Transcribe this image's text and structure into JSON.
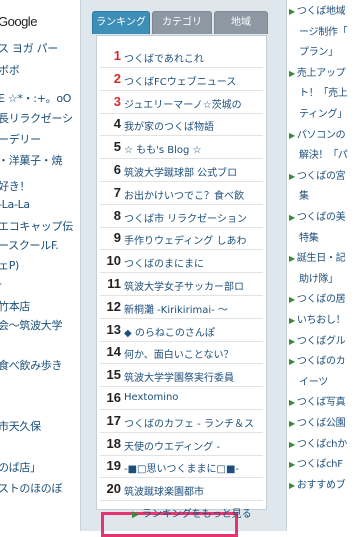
{
  "left_column": {
    "google_label": "Google",
    "items": [
      "ス ヨガ パー",
      "ボボ",
      "E ☆*・:+。oO",
      "長リラクゼーシ",
      "ーデリー",
      "・洋菓子・焼",
      "好き！",
      "-La-La",
      "エコキャップ伝",
      "ースクールF.",
      "ェP)",
      "-",
      "竹本店",
      "会〜筑波大学",
      "",
      "食べ飲み歩き",
      "",
      "",
      "市天久保",
      "",
      "のば店」",
      "ストのほのぼ"
    ]
  },
  "tabs": [
    {
      "label": "ランキング",
      "active": true
    },
    {
      "label": "カテゴリ",
      "active": false
    },
    {
      "label": "地域",
      "active": false
    }
  ],
  "ranking": [
    {
      "rank": "1",
      "title": "つくばであれこれ"
    },
    {
      "rank": "2",
      "title": "つくばFCウェブニュース"
    },
    {
      "rank": "3",
      "title": "ジュエリーマーノ☆茨城の"
    },
    {
      "rank": "4",
      "title": "我が家のつくば物語"
    },
    {
      "rank": "5",
      "title": "☆ もも's Blog ☆"
    },
    {
      "rank": "6",
      "title": "筑波大学蹴球部 公式ブロ"
    },
    {
      "rank": "7",
      "title": "お出かけいつでこ？食べ飲"
    },
    {
      "rank": "8",
      "title": "つくば市 リラクゼーション"
    },
    {
      "rank": "9",
      "title": "手作りウェディング しあわ"
    },
    {
      "rank": "10",
      "title": "つくばのまにまに"
    },
    {
      "rank": "11",
      "title": "筑波大学女子サッカー部ロ"
    },
    {
      "rank": "12",
      "title": "新桐灘 -Kirikirimai- 〜"
    },
    {
      "rank": "13",
      "title": "◆ のらねこのさんぽ"
    },
    {
      "rank": "14",
      "title": "何か、面白いことない？"
    },
    {
      "rank": "15",
      "title": "筑波大学学園祭実行委員"
    },
    {
      "rank": "16",
      "title": "Hextomino"
    },
    {
      "rank": "17",
      "title": "つくばのカフェ - ランチ＆ス"
    },
    {
      "rank": "18",
      "title": "天使のウエディング -"
    },
    {
      "rank": "19",
      "title": "-■□思いつくままに□■-"
    },
    {
      "rank": "20",
      "title": "筑波蹴球楽園都市"
    }
  ],
  "more_link": "ランキングをもっと見る",
  "right_column": [
    {
      "text": "つくば地域",
      "arrow": true
    },
    {
      "text": "ージ制作「",
      "arrow": false
    },
    {
      "text": "プラン」",
      "arrow": false
    },
    {
      "text": "売上アップ",
      "arrow": true
    },
    {
      "text": "ト！「売上",
      "arrow": false
    },
    {
      "text": "ティング」",
      "arrow": false
    },
    {
      "text": "パソコンの",
      "arrow": true
    },
    {
      "text": "解決！「パ",
      "arrow": false
    },
    {
      "text": "つくばの宮",
      "arrow": true
    },
    {
      "text": "集",
      "arrow": false
    },
    {
      "text": "つくばの美",
      "arrow": true
    },
    {
      "text": "特集",
      "arrow": false
    },
    {
      "text": "誕生日・記",
      "arrow": true
    },
    {
      "text": "助け隊」",
      "arrow": false
    },
    {
      "text": "つくばの居",
      "arrow": true
    },
    {
      "text": "いちおし！",
      "arrow": true
    },
    {
      "text": "つくばグル",
      "arrow": true
    },
    {
      "text": "つくばのカ",
      "arrow": true
    },
    {
      "text": "イーツ",
      "arrow": false
    },
    {
      "text": "つくば写真",
      "arrow": true
    },
    {
      "text": "つくば公園",
      "arrow": true
    },
    {
      "text": "つくばchか",
      "arrow": true
    },
    {
      "text": "つくばchF",
      "arrow": true
    },
    {
      "text": "おすすめブ",
      "arrow": true
    }
  ],
  "colors": {
    "tab_active": "#3d8fb8",
    "tab_inactive": "#8d98a3",
    "rank_top": "#d22c2c",
    "highlight": "#e8346e",
    "link": "#1d4f7c"
  }
}
